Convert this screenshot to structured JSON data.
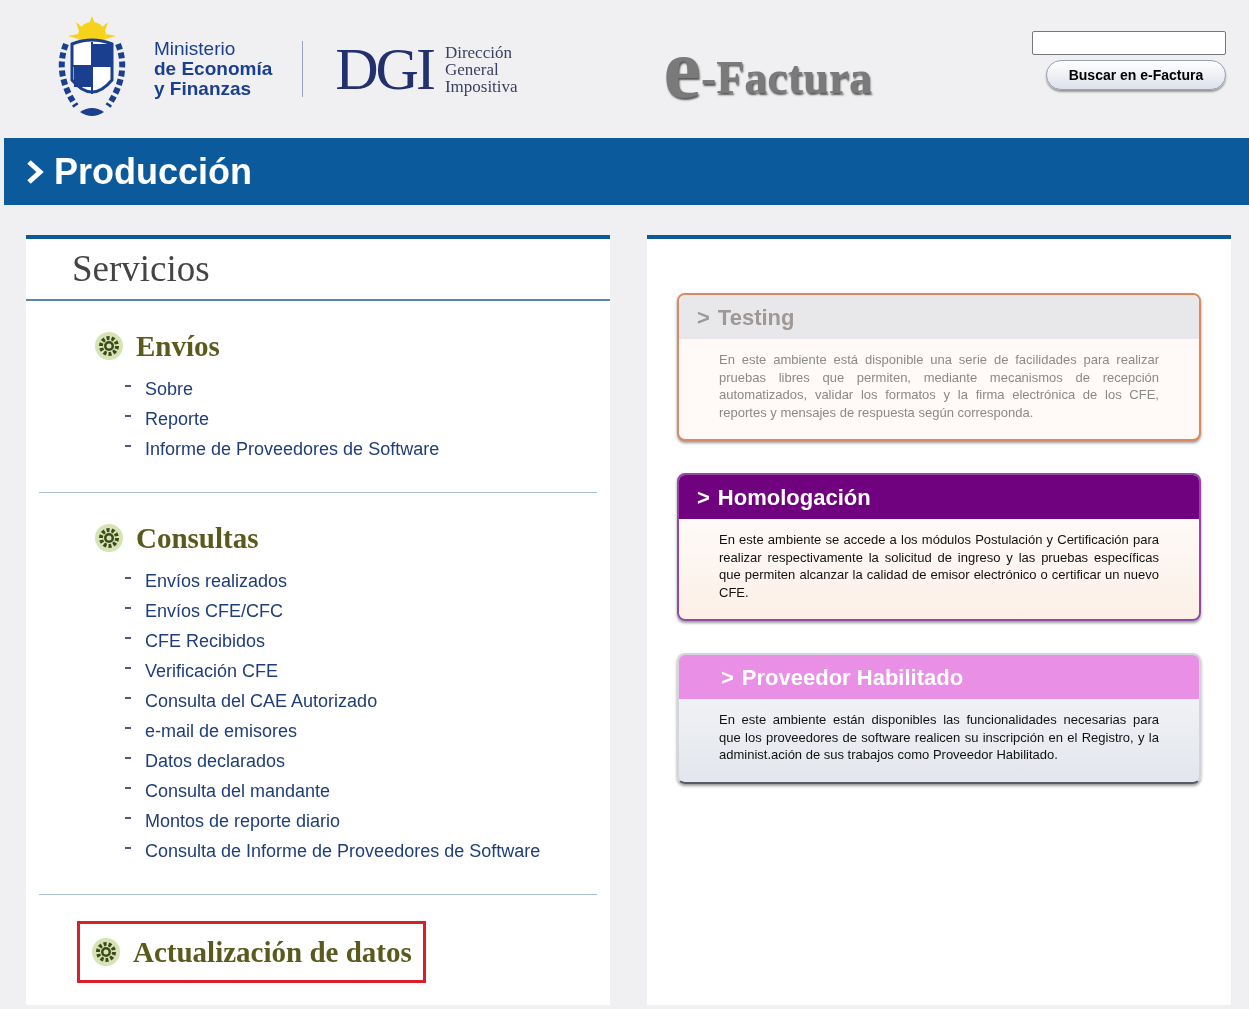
{
  "header": {
    "ministry": [
      "Ministerio",
      "de Economía",
      "y Finanzas"
    ],
    "agency_abbr": "DGI",
    "agency_name": [
      "Dirección",
      "General",
      "Impositiva"
    ],
    "product_logo": {
      "initial": "e",
      "rest": "-Factura"
    },
    "search": {
      "button": "Buscar en e-Factura"
    }
  },
  "page_title": {
    "text": "Producción"
  },
  "services": {
    "title": "Servicios",
    "sections": [
      {
        "title": "Envíos",
        "highlighted": false,
        "items": [
          "Sobre",
          "Reporte",
          "Informe de Proveedores de Software"
        ]
      },
      {
        "title": "Consultas",
        "highlighted": false,
        "items": [
          "Envíos realizados",
          "Envíos CFE/CFC",
          "CFE Recibidos",
          "Verificación CFE",
          "Consulta del CAE Autorizado",
          "e-mail de emisores",
          "Datos declarados",
          "Consulta del mandante",
          "Montos de reporte diario",
          "Consulta de Informe de Proveedores de Software"
        ]
      },
      {
        "title": "Actualización de datos",
        "highlighted": true
      }
    ]
  },
  "environments": [
    {
      "kind": "orange",
      "arrow": ">",
      "title": "Testing",
      "text": "En este ambiente está disponible una serie de facilidades para realizar pruebas libres que permiten, mediante mecanismos de recepción automatizados, validar los formatos y la firma electrónica de los CFE, reportes y mensajes de respuesta según corresponda."
    },
    {
      "kind": "purple",
      "arrow": ">",
      "title": "Homologación",
      "text": "En este ambiente se accede a los módulos Postulación y Certificación para realizar respectivamente la solicitud de ingreso y las pruebas específicas que permiten alcanzar la calidad de emisor electrónico o certificar un nuevo CFE."
    },
    {
      "kind": "pink",
      "arrow": ">",
      "title": "Proveedor Habilitado",
      "text": "En este ambiente están disponibles las funcionalidades necesarias para que los proveedores de software realicen su inscripción en el Registro, y la administ.ación de sus trabajos como Proveedor Habilitado."
    }
  ]
}
